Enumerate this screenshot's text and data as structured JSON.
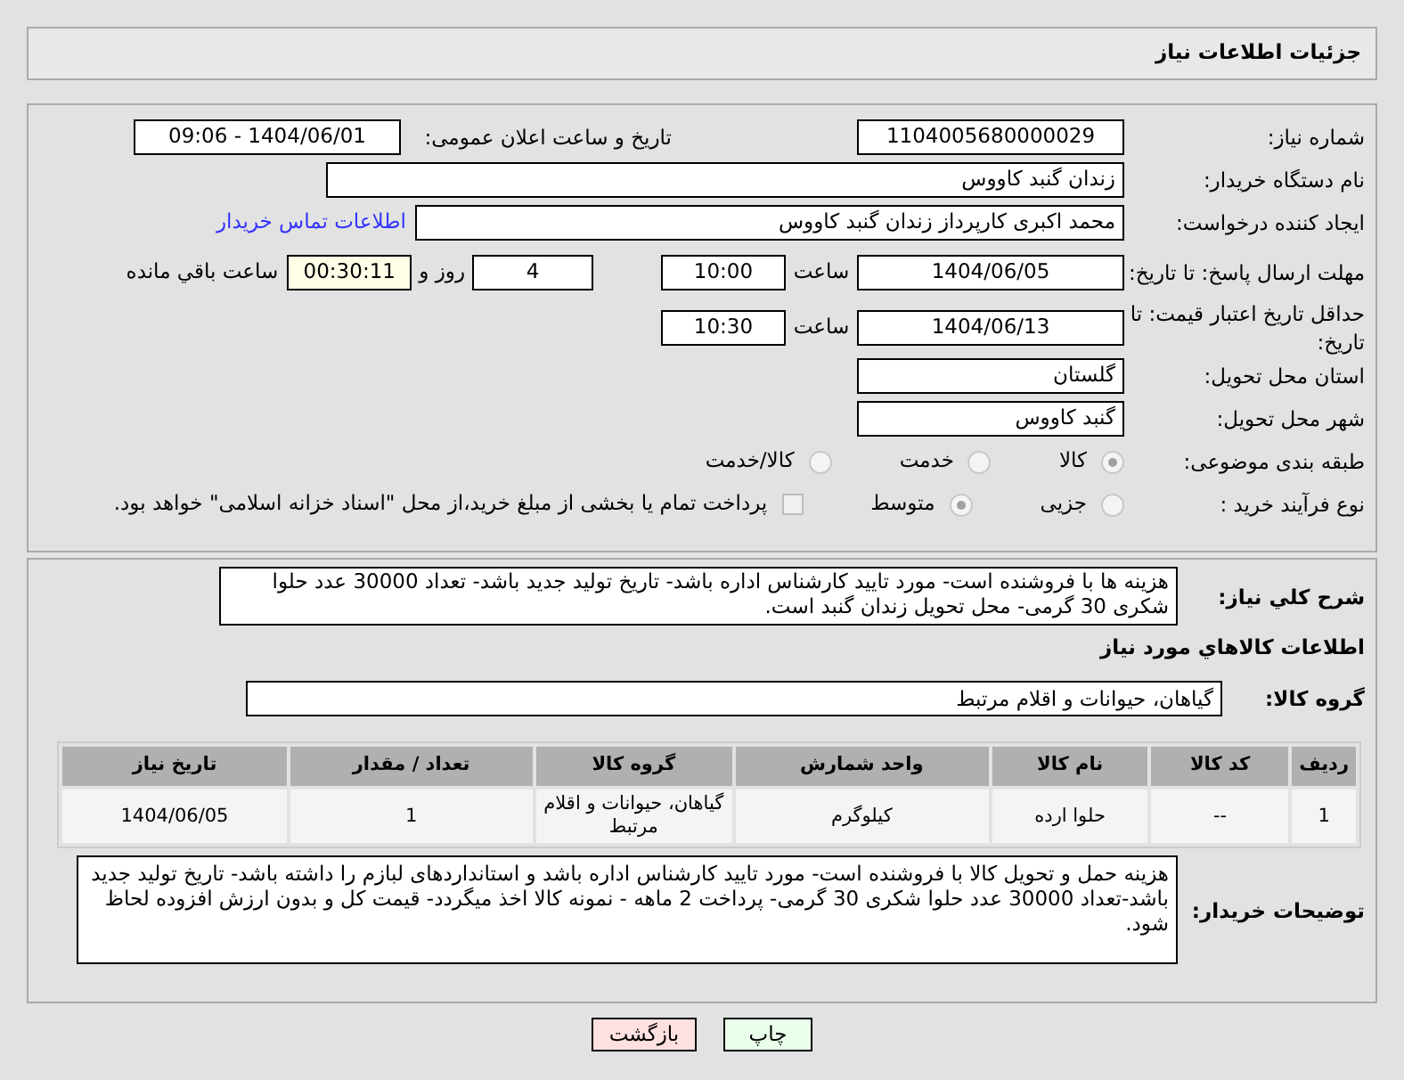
{
  "header": {
    "title": "جزئیات اطلاعات نیاز"
  },
  "need_number": {
    "label": "شماره نیاز:",
    "value": "1104005680000029"
  },
  "announce": {
    "label": "تاریخ و ساعت اعلان عمومی:",
    "value": "1404/06/01 - 09:06"
  },
  "buyer_org": {
    "label": "نام دستگاه خریدار:",
    "value": "زندان گنبد کاووس"
  },
  "creator": {
    "label": "ایجاد کننده درخواست:",
    "value": "محمد اکبری کارپرداز زندان گنبد کاووس",
    "link": "اطلاعات تماس خریدار"
  },
  "deadline": {
    "label": "مهلت ارسال پاسخ: تا تاریخ:",
    "date": "1404/06/05",
    "time_label": "ساعت",
    "time": "10:00",
    "days": "4",
    "days_label": "روز و",
    "remaining": "00:30:11",
    "remaining_label": "ساعت باقي مانده"
  },
  "validity": {
    "label": "حداقل تاریخ اعتبار قیمت: تا تاریخ:",
    "date": "1404/06/13",
    "time_label": "ساعت",
    "time": "10:30"
  },
  "province": {
    "label": "استان محل تحویل:",
    "value": "گلستان"
  },
  "city": {
    "label": "شهر محل تحویل:",
    "value": "گنبد کاووس"
  },
  "category": {
    "label": "طبقه بندی موضوعی:",
    "options": [
      {
        "label": "کالا",
        "selected": true
      },
      {
        "label": "خدمت",
        "selected": false
      },
      {
        "label": "کالا/خدمت",
        "selected": false
      }
    ]
  },
  "process": {
    "label": "نوع فرآیند خرید :",
    "options": [
      {
        "label": "جزیی",
        "selected": false
      },
      {
        "label": "متوسط",
        "selected": true
      }
    ],
    "payment": {
      "label": "پرداخت تمام یا بخشی از مبلغ خرید،از محل \"اسناد خزانه اسلامی\" خواهد بود.",
      "checked": false
    }
  },
  "description": {
    "label": "شرح کلي نیاز:",
    "value": "هزینه ها با فروشنده است- مورد تایید کارشناس اداره باشد- تاریخ تولید جدید باشد- تعداد 30000 عدد حلوا شکری 30 گرمی- محل تحویل زندان گنبد است."
  },
  "goods_heading": "اطلاعات کالاهاي مورد نیاز",
  "goods_group": {
    "label": "گروه کالا:",
    "value": "گیاهان، حیوانات و اقلام مرتبط"
  },
  "table": {
    "columns": [
      "ردیف",
      "کد کالا",
      "نام کالا",
      "واحد شمارش",
      "گروه کالا",
      "تعداد / مقدار",
      "تاریخ نیاز"
    ],
    "rows": [
      [
        "1",
        "--",
        "حلوا ارده",
        "کیلوگرم",
        "گیاهان، حیوانات و اقلام مرتبط",
        "1",
        "1404/06/05"
      ]
    ]
  },
  "buyer_notes": {
    "label": "توضیحات خریدار:",
    "value": "هزینه حمل و تحویل کالا با فروشنده است- مورد تایید کارشناس اداره باشد و استانداردهای لبازم را داشته باشد- تاریخ تولید جدید باشد-تعداد 30000 عدد حلوا شکری 30 گرمی- پرداخت 2 ماهه - نمونه کالا اخذ میگردد- قیمت کل و بدون ارزش افزوده لحاظ شود."
  },
  "buttons": [
    {
      "label": "چاپ",
      "kind": "print"
    },
    {
      "label": "بازگشت",
      "kind": "back"
    }
  ]
}
